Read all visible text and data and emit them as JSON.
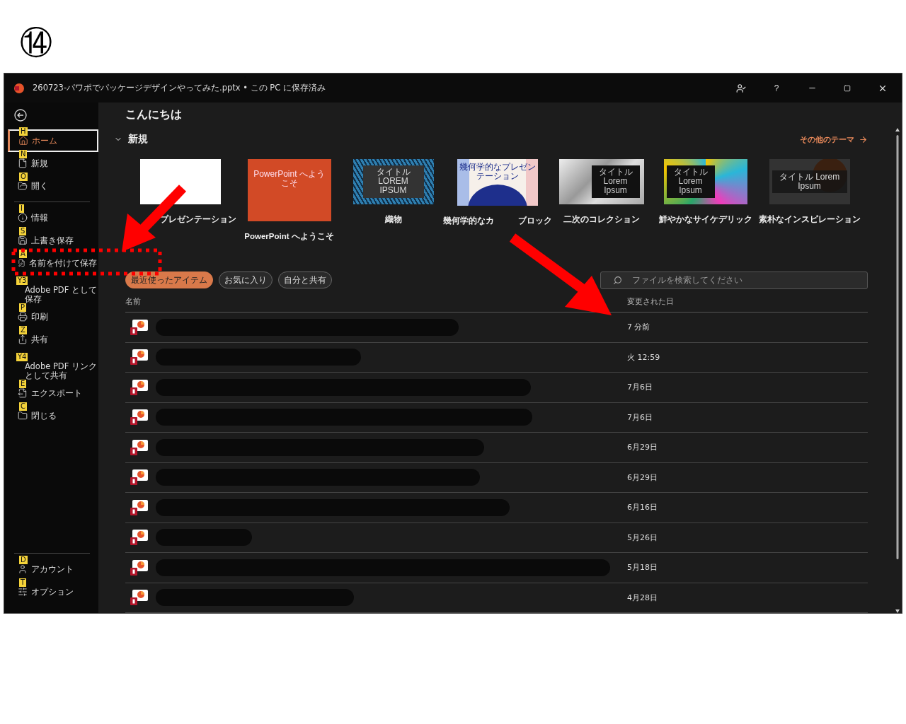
{
  "step_marker": "⑭",
  "window": {
    "title": "260723-パワポでパッケージデザインやってみた.pptx • この PC に保存済み",
    "help": "?"
  },
  "sidebar": {
    "top": [
      {
        "key": "H",
        "lines": [
          "ホーム"
        ],
        "selected": true
      },
      {
        "key": "N",
        "lines": [
          "新規"
        ],
        "selected": false
      },
      {
        "key": "O",
        "lines": [
          "開く"
        ],
        "selected": false
      }
    ],
    "middle": [
      {
        "key": "I",
        "lines": [
          "情報"
        ],
        "selected": false
      },
      {
        "key": "S",
        "lines": [
          "上書き保存"
        ],
        "selected": false
      },
      {
        "key": "A",
        "lines": [
          "名前を付けて保存"
        ],
        "selected": false
      },
      {
        "key": "Y3",
        "lines": [
          "Adobe PDF として",
          "保存"
        ],
        "selected": false
      },
      {
        "key": "P",
        "lines": [
          "印刷"
        ],
        "selected": false
      },
      {
        "key": "Z",
        "lines": [
          "共有"
        ],
        "selected": false
      },
      {
        "key": "Y4",
        "lines": [
          "Adobe PDF リンク",
          "として共有"
        ],
        "selected": false
      },
      {
        "key": "E",
        "lines": [
          "エクスポート"
        ],
        "selected": false
      },
      {
        "key": "C",
        "lines": [
          "閉じる"
        ],
        "selected": false
      }
    ],
    "bottom": [
      {
        "key": "D",
        "lines": [
          "アカウント"
        ],
        "selected": false
      },
      {
        "key": "T",
        "lines": [
          "オプション"
        ],
        "selected": false
      }
    ]
  },
  "greeting": "こんにちは",
  "new_section": {
    "title": "新規",
    "expanded": true,
    "more_link": "その他のテーマ",
    "templates": [
      {
        "kind": "blank",
        "label": "プレゼンテーション"
      },
      {
        "kind": "welcome",
        "label": "PowerPoint へようこそ",
        "thumb_text": "PowerPoint へようこそ"
      },
      {
        "kind": "weave",
        "label": "織物",
        "thumb_text": "タイトル LOREM IPSUM"
      },
      {
        "kind": "geometric",
        "label": "幾何学的なカ",
        "label_tail": "ブロック",
        "thumb_text": "幾何学的なプレゼンテーション"
      },
      {
        "kind": "polygon",
        "label": "二次のコレクション",
        "thumb_text": "タイトル Lorem Ipsum"
      },
      {
        "kind": "psychedelic",
        "label": "鮮やかなサイケデリック",
        "thumb_text": "タイトル Lorem Ipsum"
      },
      {
        "kind": "coffee",
        "label": "素朴なインスピレーション",
        "thumb_text": "タイトル Lorem Ipsum"
      }
    ]
  },
  "filters": [
    {
      "label": "最近使ったアイテム",
      "selected": true
    },
    {
      "label": "お気に入り",
      "selected": false
    },
    {
      "label": "自分と共有",
      "selected": false
    }
  ],
  "search": {
    "placeholder": "ファイルを検索してください"
  },
  "table": {
    "columns": [
      "名前",
      "変更された日"
    ],
    "rows": [
      {
        "modified": "7 分前"
      },
      {
        "modified": "火 12:59"
      },
      {
        "modified": "7月6日"
      },
      {
        "modified": "7月6日"
      },
      {
        "modified": "6月29日"
      },
      {
        "modified": "6月29日"
      },
      {
        "modified": "6月16日"
      },
      {
        "modified": "5月26日"
      },
      {
        "modified": "5月18日"
      },
      {
        "modified": "4月28日"
      }
    ]
  }
}
